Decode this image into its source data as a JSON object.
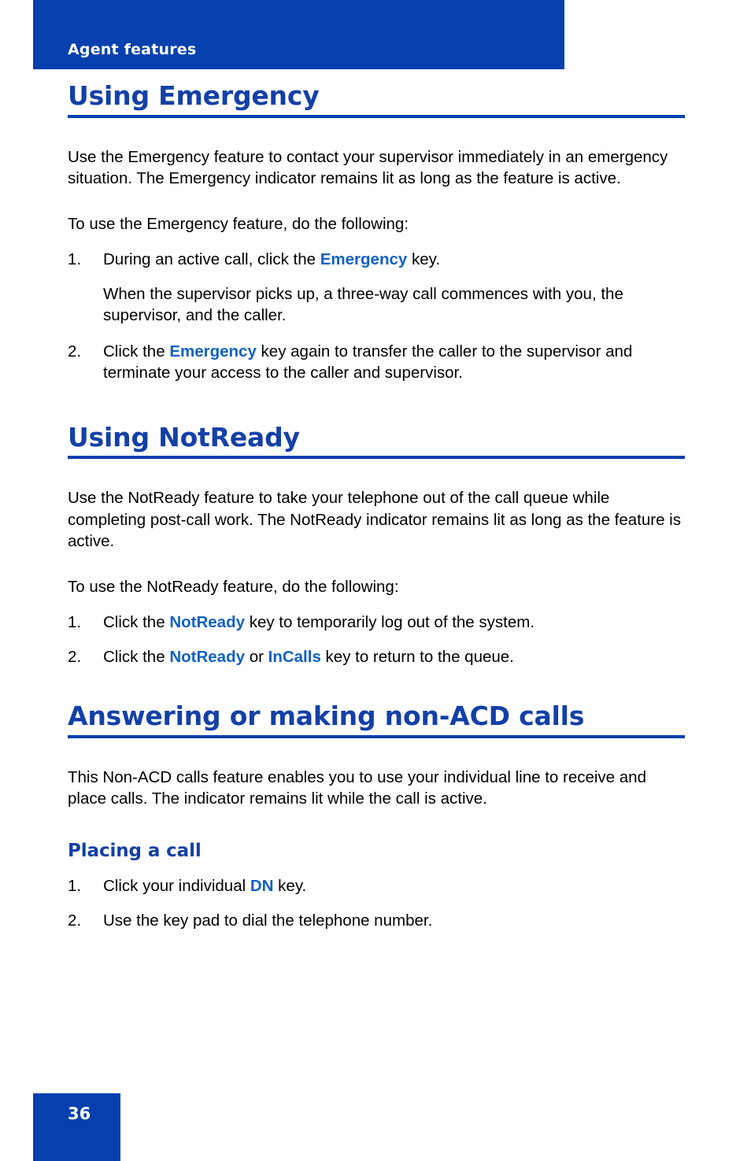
{
  "header": {
    "running_title": "Agent features",
    "banner_color": "#0540AE"
  },
  "footer": {
    "page_number": "36",
    "block_color": "#0540AE"
  },
  "colors": {
    "heading_blue": "#1340A8",
    "keyword_blue": "#1161C4",
    "rule_blue": "#0540AE",
    "body_black": "#000000"
  },
  "sections": [
    {
      "id": "using-emergency",
      "heading": "Using Emergency",
      "intro": "Use the Emergency feature to contact your supervisor immediately in an emergency situation. The Emergency indicator remains lit as long as the feature is active.",
      "lead_in": "To use the Emergency feature, do the following:",
      "steps": [
        {
          "number": "1.",
          "text_before": "During an active call, click the ",
          "keyword": "Emergency",
          "text_after": " key.",
          "sub_paragraph": "When the supervisor picks up, a three-way call commences with you, the supervisor, and the caller."
        },
        {
          "number": "2.",
          "text_before": "Click the ",
          "keyword": "Emergency",
          "text_after": " key again to transfer the caller to the supervisor and terminate your access to the caller and supervisor.",
          "sub_paragraph": ""
        }
      ]
    },
    {
      "id": "using-notready",
      "heading": "Using NotReady",
      "intro": "Use the NotReady feature to take your telephone out of the call queue while completing post-call work. The NotReady indicator remains lit as long as the feature is active.",
      "lead_in": "To use the NotReady feature, do the following:",
      "steps": [
        {
          "number": "1.",
          "text_before": "Click the ",
          "keyword": "NotReady",
          "text_after": " key to temporarily log out of the system.",
          "keyword2": "",
          "text_mid": ""
        },
        {
          "number": "2.",
          "text_before": "Click the ",
          "keyword": "NotReady",
          "text_mid": " or ",
          "keyword2": "InCalls",
          "text_after": " key to return to the queue."
        }
      ]
    },
    {
      "id": "non-acd-calls",
      "heading": "Answering or making non-ACD calls",
      "intro": "This Non-ACD calls feature enables you to use your individual line to receive and place calls. The indicator remains lit while the call is active.",
      "subsection": {
        "heading": "Placing a call",
        "steps": [
          {
            "number": "1.",
            "text_before": "Click your individual ",
            "keyword": "DN",
            "text_after": " key."
          },
          {
            "number": "2.",
            "text_before": "Use the key pad to dial the telephone number.",
            "keyword": "",
            "text_after": ""
          }
        ]
      }
    }
  ]
}
